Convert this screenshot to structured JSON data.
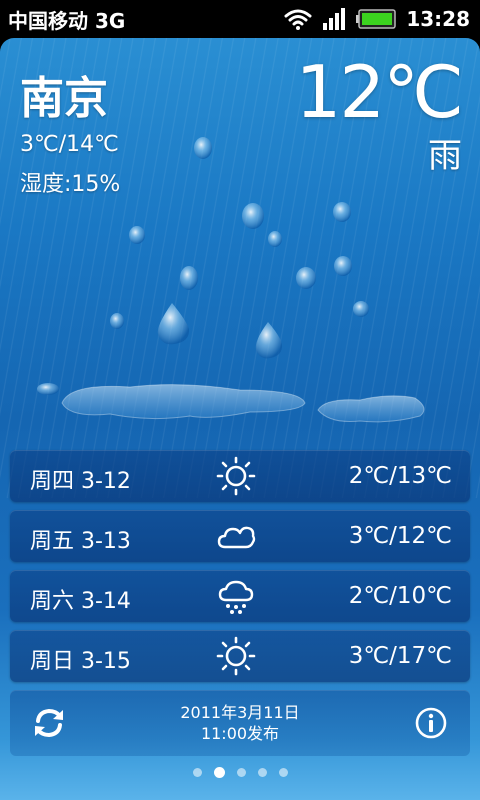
{
  "status_bar": {
    "carrier": "中国移动 3G",
    "time": "13:28",
    "battery_color": "#3cd31f"
  },
  "current": {
    "city": "南京",
    "temperature": "12℃",
    "condition": "雨",
    "range": "3℃/14℃",
    "humidity": "湿度:15%"
  },
  "forecast": [
    {
      "day": "周四 3-12",
      "icon": "sunny-icon",
      "temp": "2℃/13℃"
    },
    {
      "day": "周五 3-13",
      "icon": "cloudy-icon",
      "temp": "3℃/12℃"
    },
    {
      "day": "周六 3-14",
      "icon": "rain-cloud-icon",
      "temp": "2℃/10℃"
    },
    {
      "day": "周日 3-15",
      "icon": "sunny-icon",
      "temp": "3℃/17℃"
    }
  ],
  "footer": {
    "publish_date": "2011年3月11日",
    "publish_time": "11:00发布"
  },
  "pager": {
    "pages": 5,
    "active": 1
  },
  "colors": {
    "background_top": "#2a8fd3",
    "background_bottom": "#5ab3ea",
    "row_bg": "#0a3c82"
  }
}
